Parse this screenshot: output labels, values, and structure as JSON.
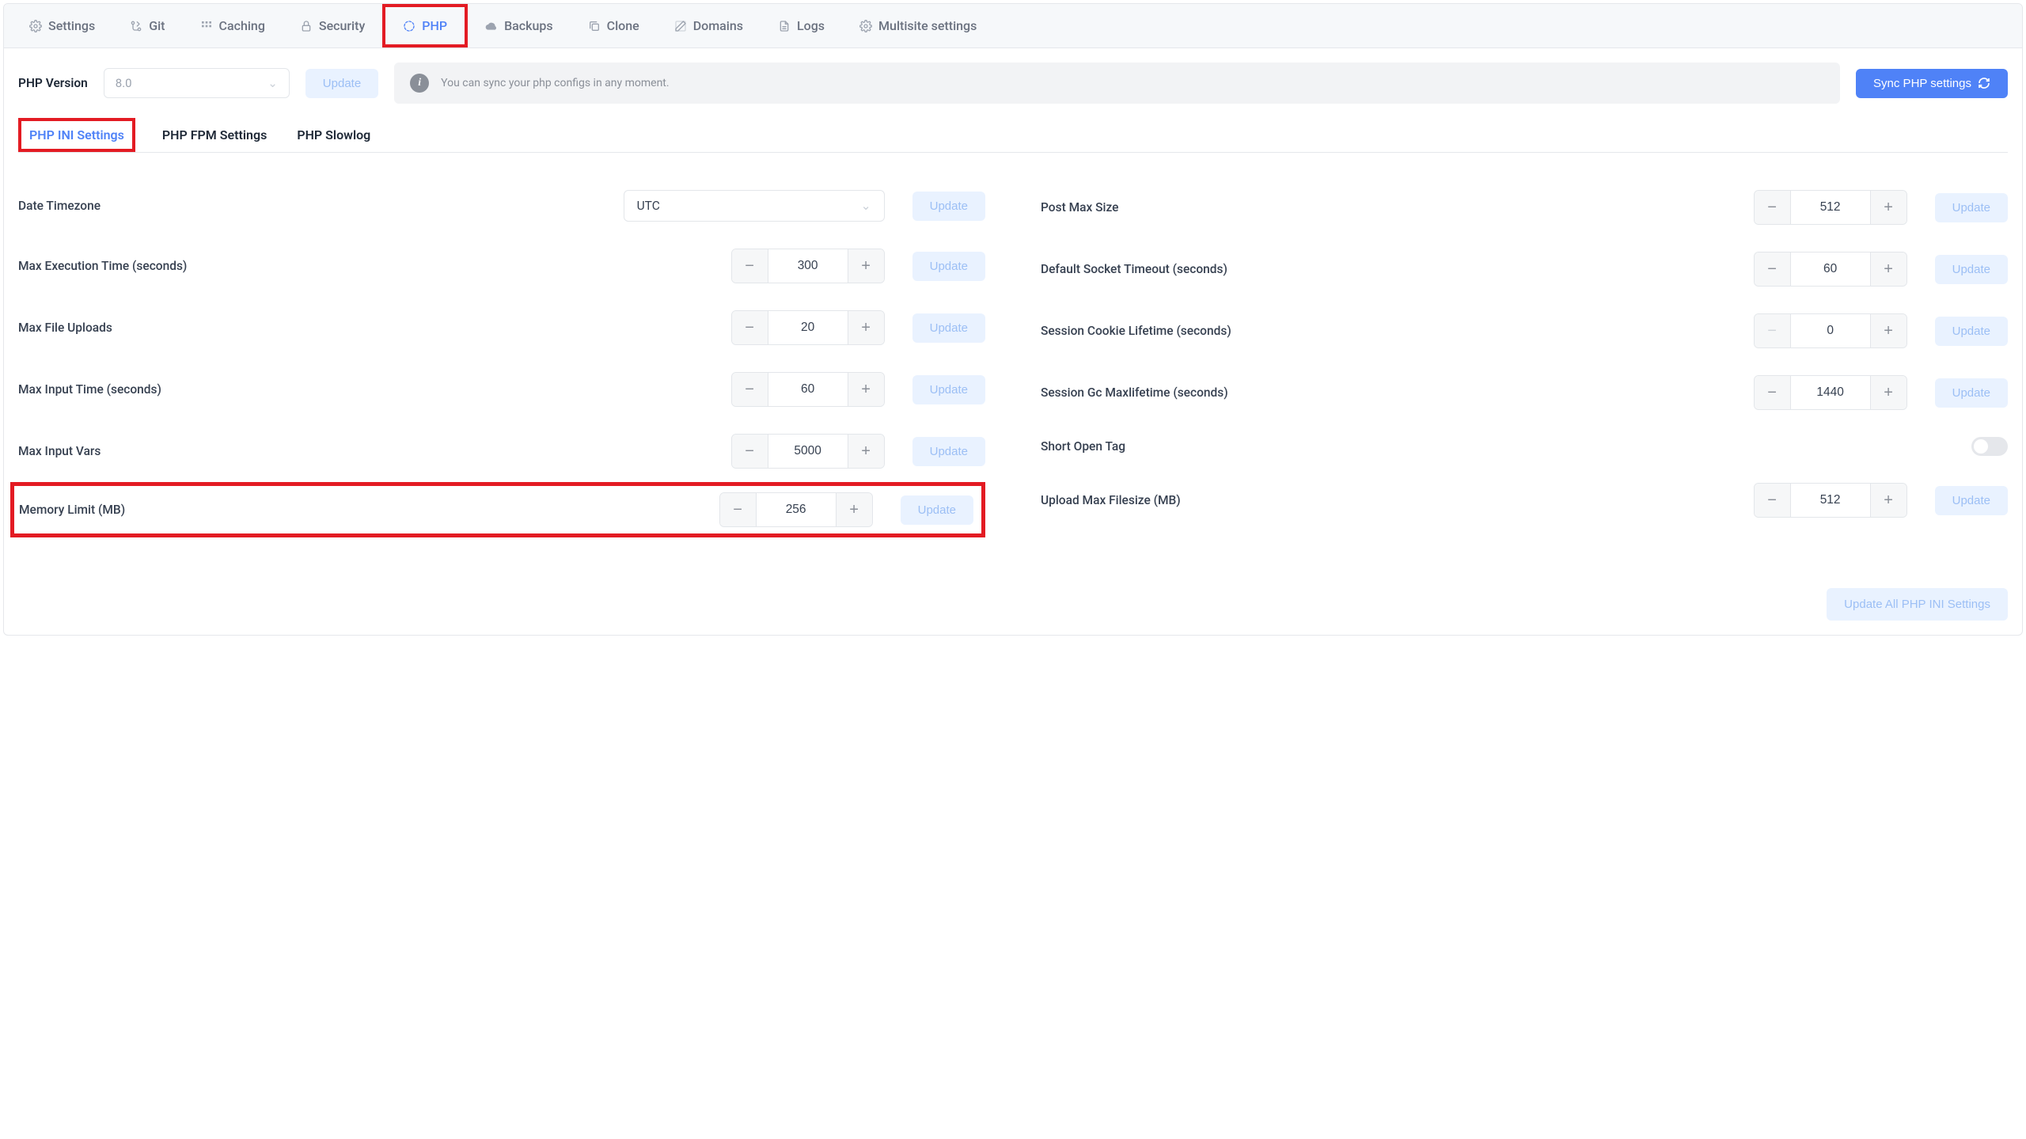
{
  "topTabs": [
    {
      "icon": "gear",
      "label": "Settings"
    },
    {
      "icon": "git",
      "label": "Git"
    },
    {
      "icon": "grid",
      "label": "Caching"
    },
    {
      "icon": "lock",
      "label": "Security"
    },
    {
      "icon": "php",
      "label": "PHP",
      "active": true,
      "highlight": true
    },
    {
      "icon": "cloud",
      "label": "Backups"
    },
    {
      "icon": "copy",
      "label": "Clone"
    },
    {
      "icon": "edit",
      "label": "Domains"
    },
    {
      "icon": "file",
      "label": "Logs"
    },
    {
      "icon": "gear",
      "label": "Multisite settings"
    }
  ],
  "phpVersion": {
    "label": "PHP Version",
    "value": "8.0",
    "updateLabel": "Update"
  },
  "infoText": "You can sync your php configs in any moment.",
  "syncLabel": "Sync PHP settings",
  "subTabs": [
    {
      "label": "PHP INI Settings",
      "active": true,
      "highlight": true
    },
    {
      "label": "PHP FPM Settings"
    },
    {
      "label": "PHP Slowlog"
    }
  ],
  "left": [
    {
      "type": "select",
      "label": "Date Timezone",
      "value": "UTC",
      "update": "Update"
    },
    {
      "type": "stepper",
      "label": "Max Execution Time (seconds)",
      "value": "300",
      "update": "Update"
    },
    {
      "type": "stepper",
      "label": "Max File Uploads",
      "value": "20",
      "update": "Update"
    },
    {
      "type": "stepper",
      "label": "Max Input Time (seconds)",
      "value": "60",
      "update": "Update"
    },
    {
      "type": "stepper",
      "label": "Max Input Vars",
      "value": "5000",
      "update": "Update"
    },
    {
      "type": "stepper",
      "label": "Memory Limit (MB)",
      "value": "256",
      "update": "Update",
      "highlight": true
    }
  ],
  "right": [
    {
      "type": "stepper",
      "label": "Post Max Size",
      "value": "512",
      "update": "Update"
    },
    {
      "type": "stepper",
      "label": "Default Socket Timeout (seconds)",
      "value": "60",
      "update": "Update"
    },
    {
      "type": "stepper",
      "label": "Session Cookie Lifetime (seconds)",
      "value": "0",
      "update": "Update",
      "minusDisabled": true
    },
    {
      "type": "stepper",
      "label": "Session Gc Maxlifetime (seconds)",
      "value": "1440",
      "update": "Update"
    },
    {
      "type": "toggle",
      "label": "Short Open Tag"
    },
    {
      "type": "stepper",
      "label": "Upload Max Filesize (MB)",
      "value": "512",
      "update": "Update"
    }
  ],
  "updateAll": "Update All PHP INI Settings"
}
